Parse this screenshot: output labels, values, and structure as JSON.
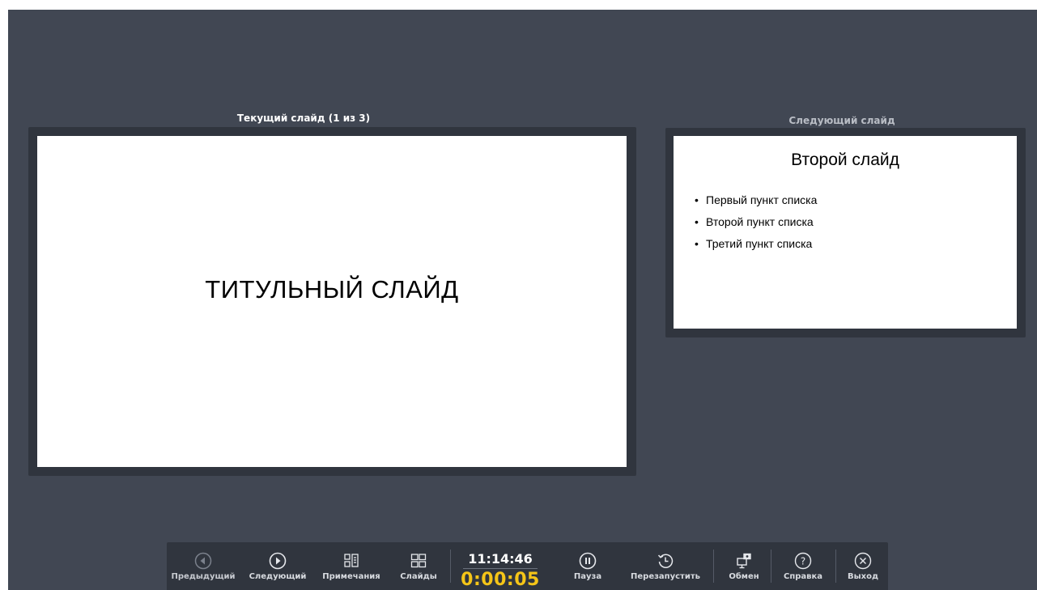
{
  "current_pane": {
    "label": "Текущий слайд (1 из 3)",
    "slide_title": "ТИТУЛЬНЫЙ СЛАЙД"
  },
  "next_pane": {
    "label": "Следующий слайд",
    "slide_title": "Второй слайд",
    "bullets": [
      "Первый пункт списка",
      "Второй пункт списка",
      "Третий пункт списка"
    ]
  },
  "toolbar": {
    "prev_label": "Предыдущий",
    "next_label": "Следующий",
    "notes_label": "Примечания",
    "slides_label": "Слайды",
    "clock_time": "11:14:46",
    "elapsed_time": "0:00:05",
    "pause_label": "Пауза",
    "restart_label": "Перезапустить",
    "exchange_label": "Обмен",
    "help_label": "Справка",
    "exit_label": "Выход"
  },
  "icons": {
    "prev": "prev-circle-icon",
    "next": "next-circle-icon",
    "notes": "notes-icon",
    "slides": "slides-grid-icon",
    "pause": "pause-circle-icon",
    "restart": "restart-clock-icon",
    "exchange": "share-screen-icon",
    "help": "help-circle-icon",
    "exit": "close-circle-icon"
  },
  "colors": {
    "background": "#414753",
    "frame": "#30353e",
    "elapsed_accent": "#f5c518"
  }
}
